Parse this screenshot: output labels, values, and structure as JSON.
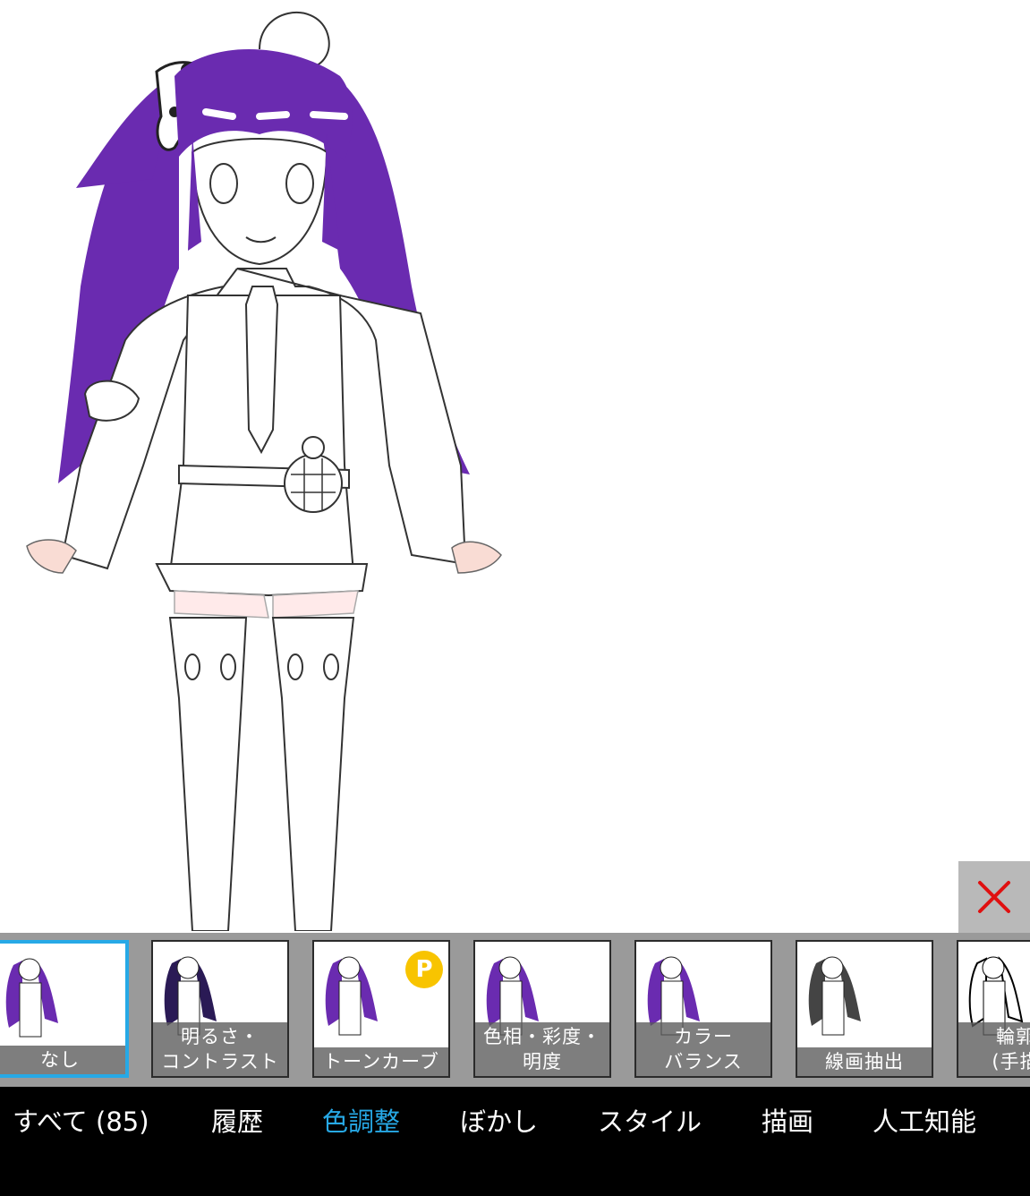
{
  "close": {
    "icon": "close-icon"
  },
  "filters": [
    {
      "label": "なし",
      "selected": true,
      "pro": false
    },
    {
      "label": "明るさ・\nコントラスト",
      "selected": false,
      "pro": false
    },
    {
      "label": "トーンカーブ",
      "selected": false,
      "pro": true
    },
    {
      "label": "色相・彩度・\n明度",
      "selected": false,
      "pro": false
    },
    {
      "label": "カラー\nバランス",
      "selected": false,
      "pro": false
    },
    {
      "label": "線画抽出",
      "selected": false,
      "pro": false
    },
    {
      "label": "輪郭線\n(手描き",
      "selected": false,
      "pro": false
    }
  ],
  "pro_badge": "P",
  "tabs": [
    {
      "label": "すべて (85)",
      "active": false
    },
    {
      "label": "履歴",
      "active": false
    },
    {
      "label": "色調整",
      "active": true
    },
    {
      "label": "ぼかし",
      "active": false
    },
    {
      "label": "スタイル",
      "active": false
    },
    {
      "label": "描画",
      "active": false
    },
    {
      "label": "人工知能",
      "active": false
    }
  ],
  "colors": {
    "accent": "#27a9e6",
    "close": "#e01010",
    "hair": "#6a2bb0",
    "pro": "#f8c400"
  }
}
